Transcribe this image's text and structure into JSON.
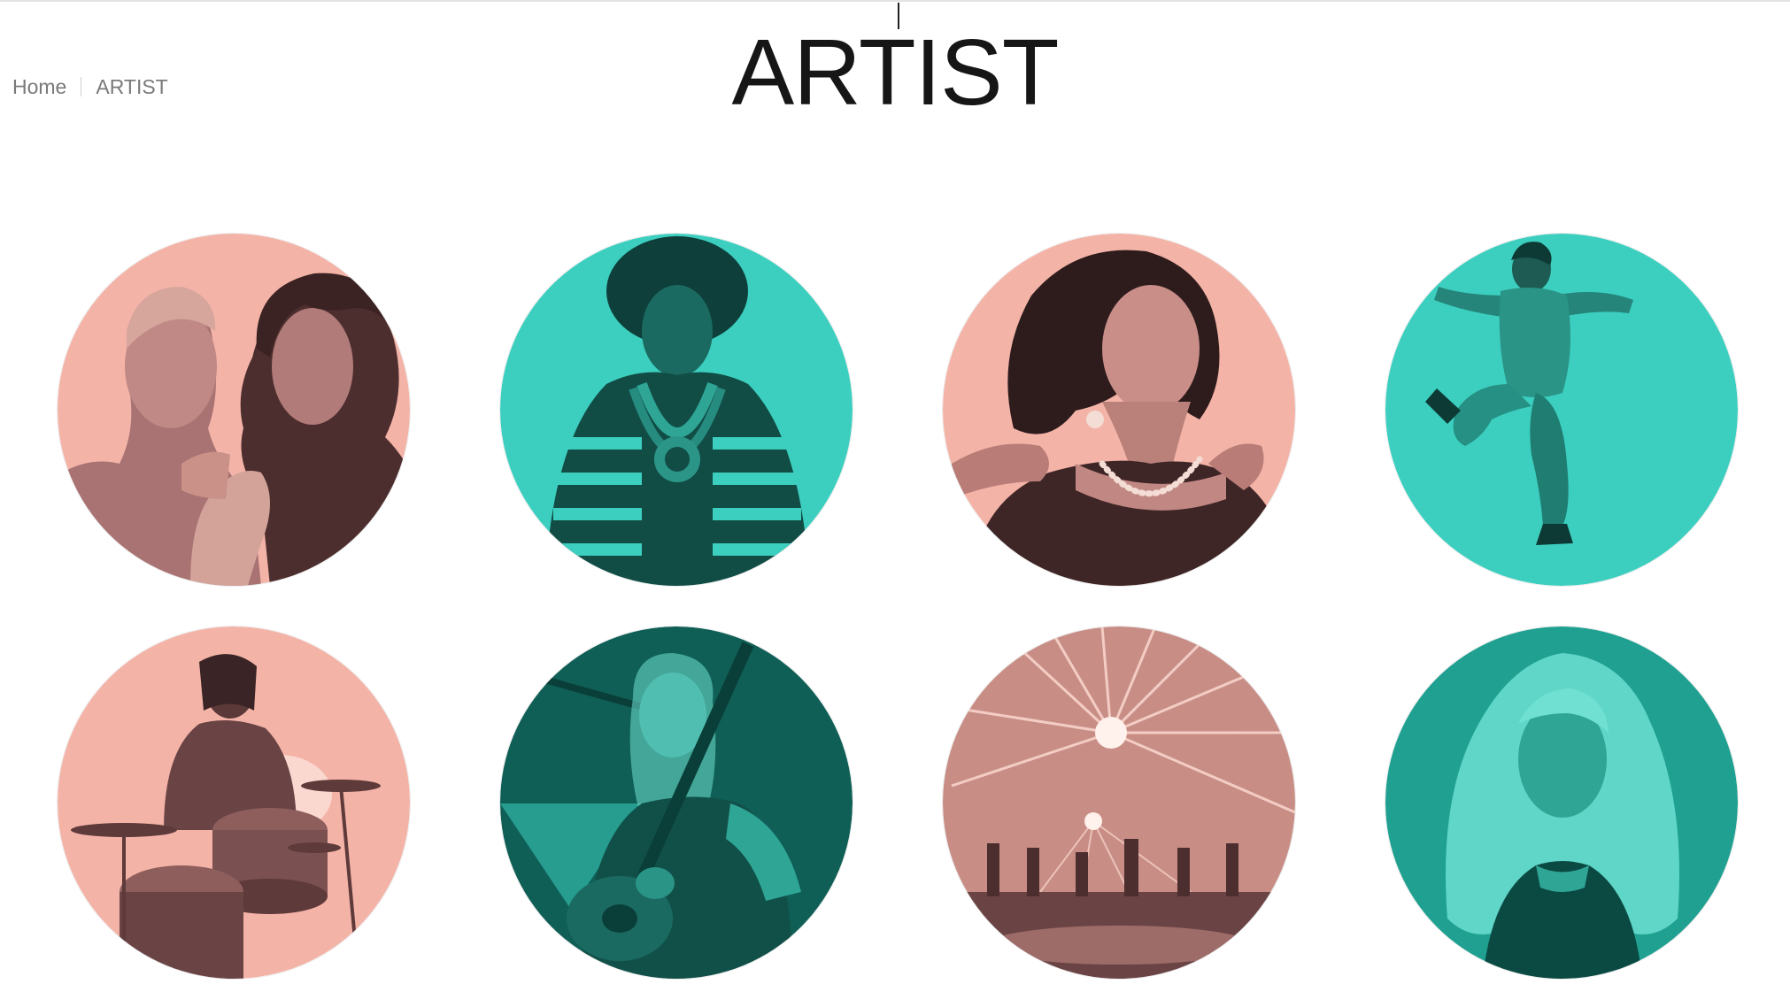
{
  "breadcrumb": {
    "home": "Home",
    "current": "ARTIST"
  },
  "page": {
    "title": "ARTIST"
  },
  "colors": {
    "pink": "#F4B3A7",
    "pink_dark": "#5E3A3A",
    "teal": "#3CCFBF",
    "teal_dark": "#0C5A52",
    "title": "#161616",
    "breadcrumb": "#7A7A7A"
  },
  "artists": [
    {
      "tint": "pink",
      "subject": "two-men-portrait"
    },
    {
      "tint": "teal",
      "subject": "man-with-afro-and-necklaces"
    },
    {
      "tint": "pink",
      "subject": "woman-with-pearl-necklace"
    },
    {
      "tint": "teal",
      "subject": "jumping-man-in-jumpsuit"
    },
    {
      "tint": "pink",
      "subject": "drummer-at-drum-kit"
    },
    {
      "tint": "teal",
      "subject": "singer-with-guitar"
    },
    {
      "tint": "pink",
      "subject": "concert-stage-lights"
    },
    {
      "tint": "teal",
      "subject": "woman-with-long-wavy-hair"
    }
  ]
}
